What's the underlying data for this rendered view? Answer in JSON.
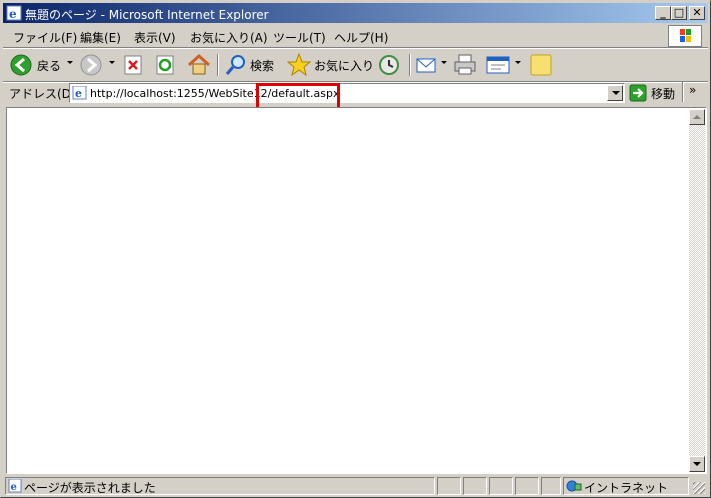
{
  "window": {
    "title": "無題のページ - Microsoft Internet Explorer",
    "minimize": "_",
    "maximize": "□",
    "close": "✕"
  },
  "menu": {
    "items": [
      "ファイル(F)",
      "編集(E)",
      "表示(V)",
      "お気に入り(A)",
      "ツール(T)",
      "ヘルプ(H)"
    ]
  },
  "toolbar": {
    "back_label": "戻る",
    "search_label": "検索",
    "favorites_label": "お気に入り",
    "icons": [
      "back-arrow-icon",
      "forward-arrow-icon",
      "stop-icon",
      "refresh-icon",
      "home-icon",
      "search-icon",
      "favorites-star-icon",
      "history-icon",
      "mail-icon",
      "print-icon",
      "edit-icon",
      "messenger-icon"
    ]
  },
  "address": {
    "label": "アドレス(D)",
    "url": "http://localhost:1255/WebSite12/default.aspx",
    "go_label": "移動",
    "links": "»"
  },
  "status": {
    "text": "ページが表示されました",
    "zone": "イントラネット"
  },
  "colors": {
    "title_start": "#0a246a",
    "title_end": "#a6caf0",
    "highlight": "#e00000"
  }
}
